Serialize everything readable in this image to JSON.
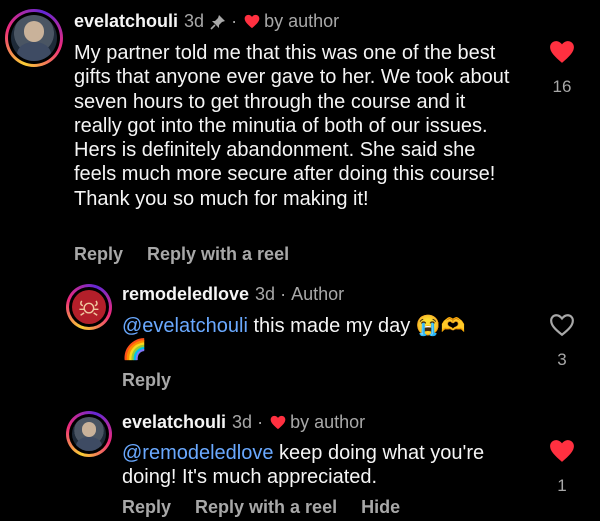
{
  "comments": [
    {
      "username": "evelatchouli",
      "time": "3d",
      "author_note": "by author",
      "text": "My partner told me that this was one of the best gifts that anyone ever gave to her. We took about seven hours to get through the course and it really got into the minutia of both of our issues. Hers is definitely abandonment. She said she feels much more secure after doing this course! Thank you so much for making it!",
      "actions": [
        "Reply",
        "Reply with a reel"
      ],
      "likes": "16",
      "liked": true
    },
    {
      "username": "remodeledlove",
      "time": "3d",
      "role": "Author",
      "mention": "@evelatchouli",
      "text": " this made my day 😭🫶",
      "text_line2": "🌈",
      "actions": [
        "Reply"
      ],
      "likes": "3",
      "liked": false
    },
    {
      "username": "evelatchouli",
      "time": "3d",
      "author_note": "by author",
      "mention": "@remodeledlove",
      "text": " keep doing what you're doing! It's much appreciated.",
      "actions": [
        "Reply",
        "Reply with a reel",
        "Hide"
      ],
      "likes": "1",
      "liked": true
    }
  ],
  "colors": {
    "heart": "#ff3040",
    "mention": "#6aa9ff",
    "muted": "#a8a8a8"
  },
  "icons": [
    "pin-icon",
    "heart-icon",
    "crab-logo"
  ]
}
